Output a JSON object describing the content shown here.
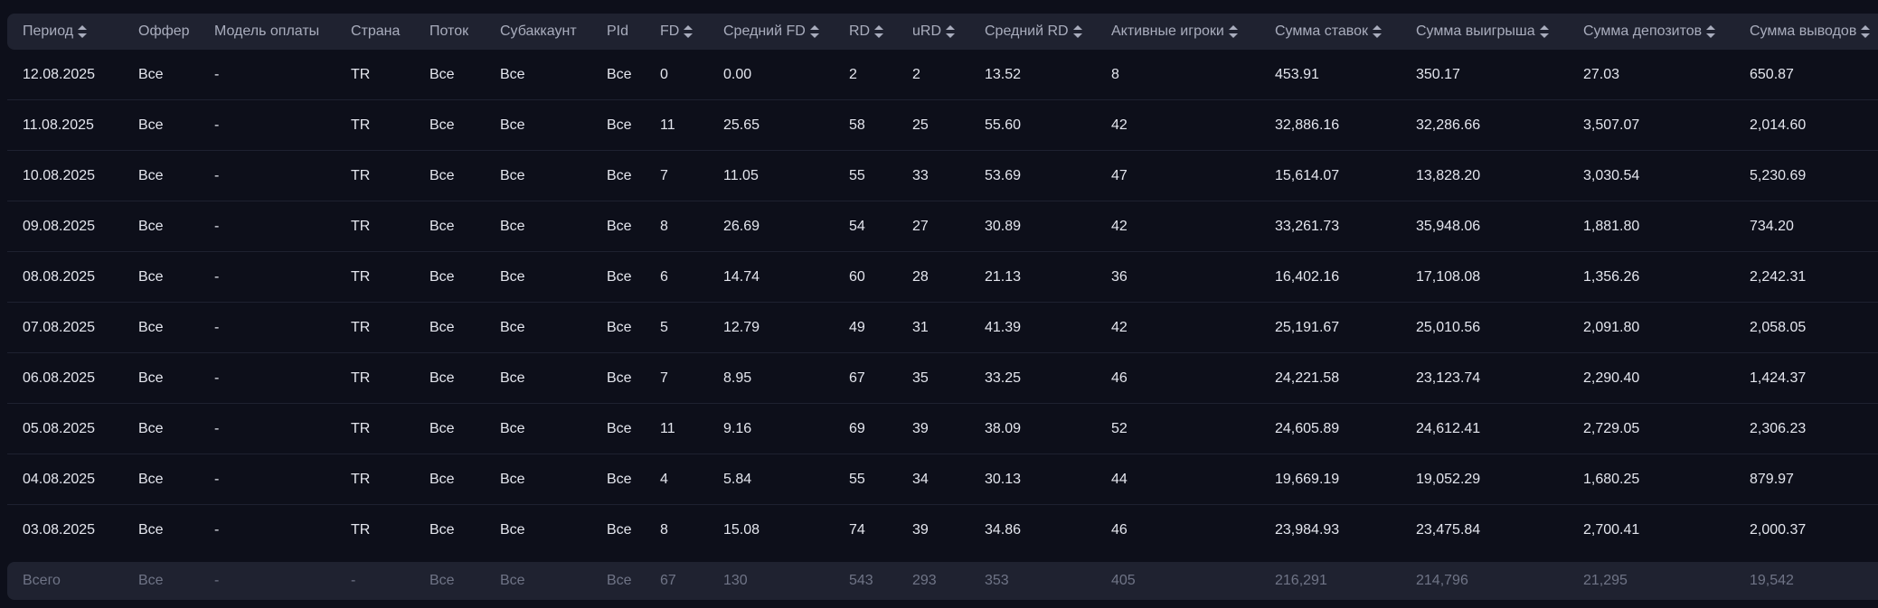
{
  "columns": [
    {
      "label": "Период",
      "sortable": true
    },
    {
      "label": "Оффер",
      "sortable": false
    },
    {
      "label": "Модель оплаты",
      "sortable": false
    },
    {
      "label": "Страна",
      "sortable": false
    },
    {
      "label": "Поток",
      "sortable": false
    },
    {
      "label": "Субаккаунт",
      "sortable": false
    },
    {
      "label": "PId",
      "sortable": false
    },
    {
      "label": "FD",
      "sortable": true
    },
    {
      "label": "Средний FD",
      "sortable": true
    },
    {
      "label": "RD",
      "sortable": true
    },
    {
      "label": "uRD",
      "sortable": true
    },
    {
      "label": "Средний RD",
      "sortable": true
    },
    {
      "label": "Активные игроки",
      "sortable": true
    },
    {
      "label": "Сумма ставок",
      "sortable": true
    },
    {
      "label": "Сумма выигрыша",
      "sortable": true
    },
    {
      "label": "Сумма депозитов",
      "sortable": true
    },
    {
      "label": "Сумма выводов",
      "sortable": true
    }
  ],
  "rows": [
    [
      "12.08.2025",
      "Все",
      "-",
      "TR",
      "Все",
      "Все",
      "Все",
      "0",
      "0.00",
      "2",
      "2",
      "13.52",
      "8",
      "453.91",
      "350.17",
      "27.03",
      "650.87"
    ],
    [
      "11.08.2025",
      "Все",
      "-",
      "TR",
      "Все",
      "Все",
      "Все",
      "11",
      "25.65",
      "58",
      "25",
      "55.60",
      "42",
      "32,886.16",
      "32,286.66",
      "3,507.07",
      "2,014.60"
    ],
    [
      "10.08.2025",
      "Все",
      "-",
      "TR",
      "Все",
      "Все",
      "Все",
      "7",
      "11.05",
      "55",
      "33",
      "53.69",
      "47",
      "15,614.07",
      "13,828.20",
      "3,030.54",
      "5,230.69"
    ],
    [
      "09.08.2025",
      "Все",
      "-",
      "TR",
      "Все",
      "Все",
      "Все",
      "8",
      "26.69",
      "54",
      "27",
      "30.89",
      "42",
      "33,261.73",
      "35,948.06",
      "1,881.80",
      "734.20"
    ],
    [
      "08.08.2025",
      "Все",
      "-",
      "TR",
      "Все",
      "Все",
      "Все",
      "6",
      "14.74",
      "60",
      "28",
      "21.13",
      "36",
      "16,402.16",
      "17,108.08",
      "1,356.26",
      "2,242.31"
    ],
    [
      "07.08.2025",
      "Все",
      "-",
      "TR",
      "Все",
      "Все",
      "Все",
      "5",
      "12.79",
      "49",
      "31",
      "41.39",
      "42",
      "25,191.67",
      "25,010.56",
      "2,091.80",
      "2,058.05"
    ],
    [
      "06.08.2025",
      "Все",
      "-",
      "TR",
      "Все",
      "Все",
      "Все",
      "7",
      "8.95",
      "67",
      "35",
      "33.25",
      "46",
      "24,221.58",
      "23,123.74",
      "2,290.40",
      "1,424.37"
    ],
    [
      "05.08.2025",
      "Все",
      "-",
      "TR",
      "Все",
      "Все",
      "Все",
      "11",
      "9.16",
      "69",
      "39",
      "38.09",
      "52",
      "24,605.89",
      "24,612.41",
      "2,729.05",
      "2,306.23"
    ],
    [
      "04.08.2025",
      "Все",
      "-",
      "TR",
      "Все",
      "Все",
      "Все",
      "4",
      "5.84",
      "55",
      "34",
      "30.13",
      "44",
      "19,669.19",
      "19,052.29",
      "1,680.25",
      "879.97"
    ],
    [
      "03.08.2025",
      "Все",
      "-",
      "TR",
      "Все",
      "Все",
      "Все",
      "8",
      "15.08",
      "74",
      "39",
      "34.86",
      "46",
      "23,984.93",
      "23,475.84",
      "2,700.41",
      "2,000.37"
    ]
  ],
  "totals": [
    "Всего",
    "Все",
    "-",
    "-",
    "Все",
    "Все",
    "Все",
    "67",
    "130",
    "543",
    "293",
    "353",
    "405",
    "216,291",
    "214,796",
    "21,295",
    "19,542"
  ],
  "colors": {
    "background": "#0d0f1a",
    "header_bg": "#1f2230",
    "header_text": "#a9adbd",
    "cell_text": "#e4e6ee",
    "totals_text": "#6f7486",
    "row_divider": "#1e2130"
  }
}
